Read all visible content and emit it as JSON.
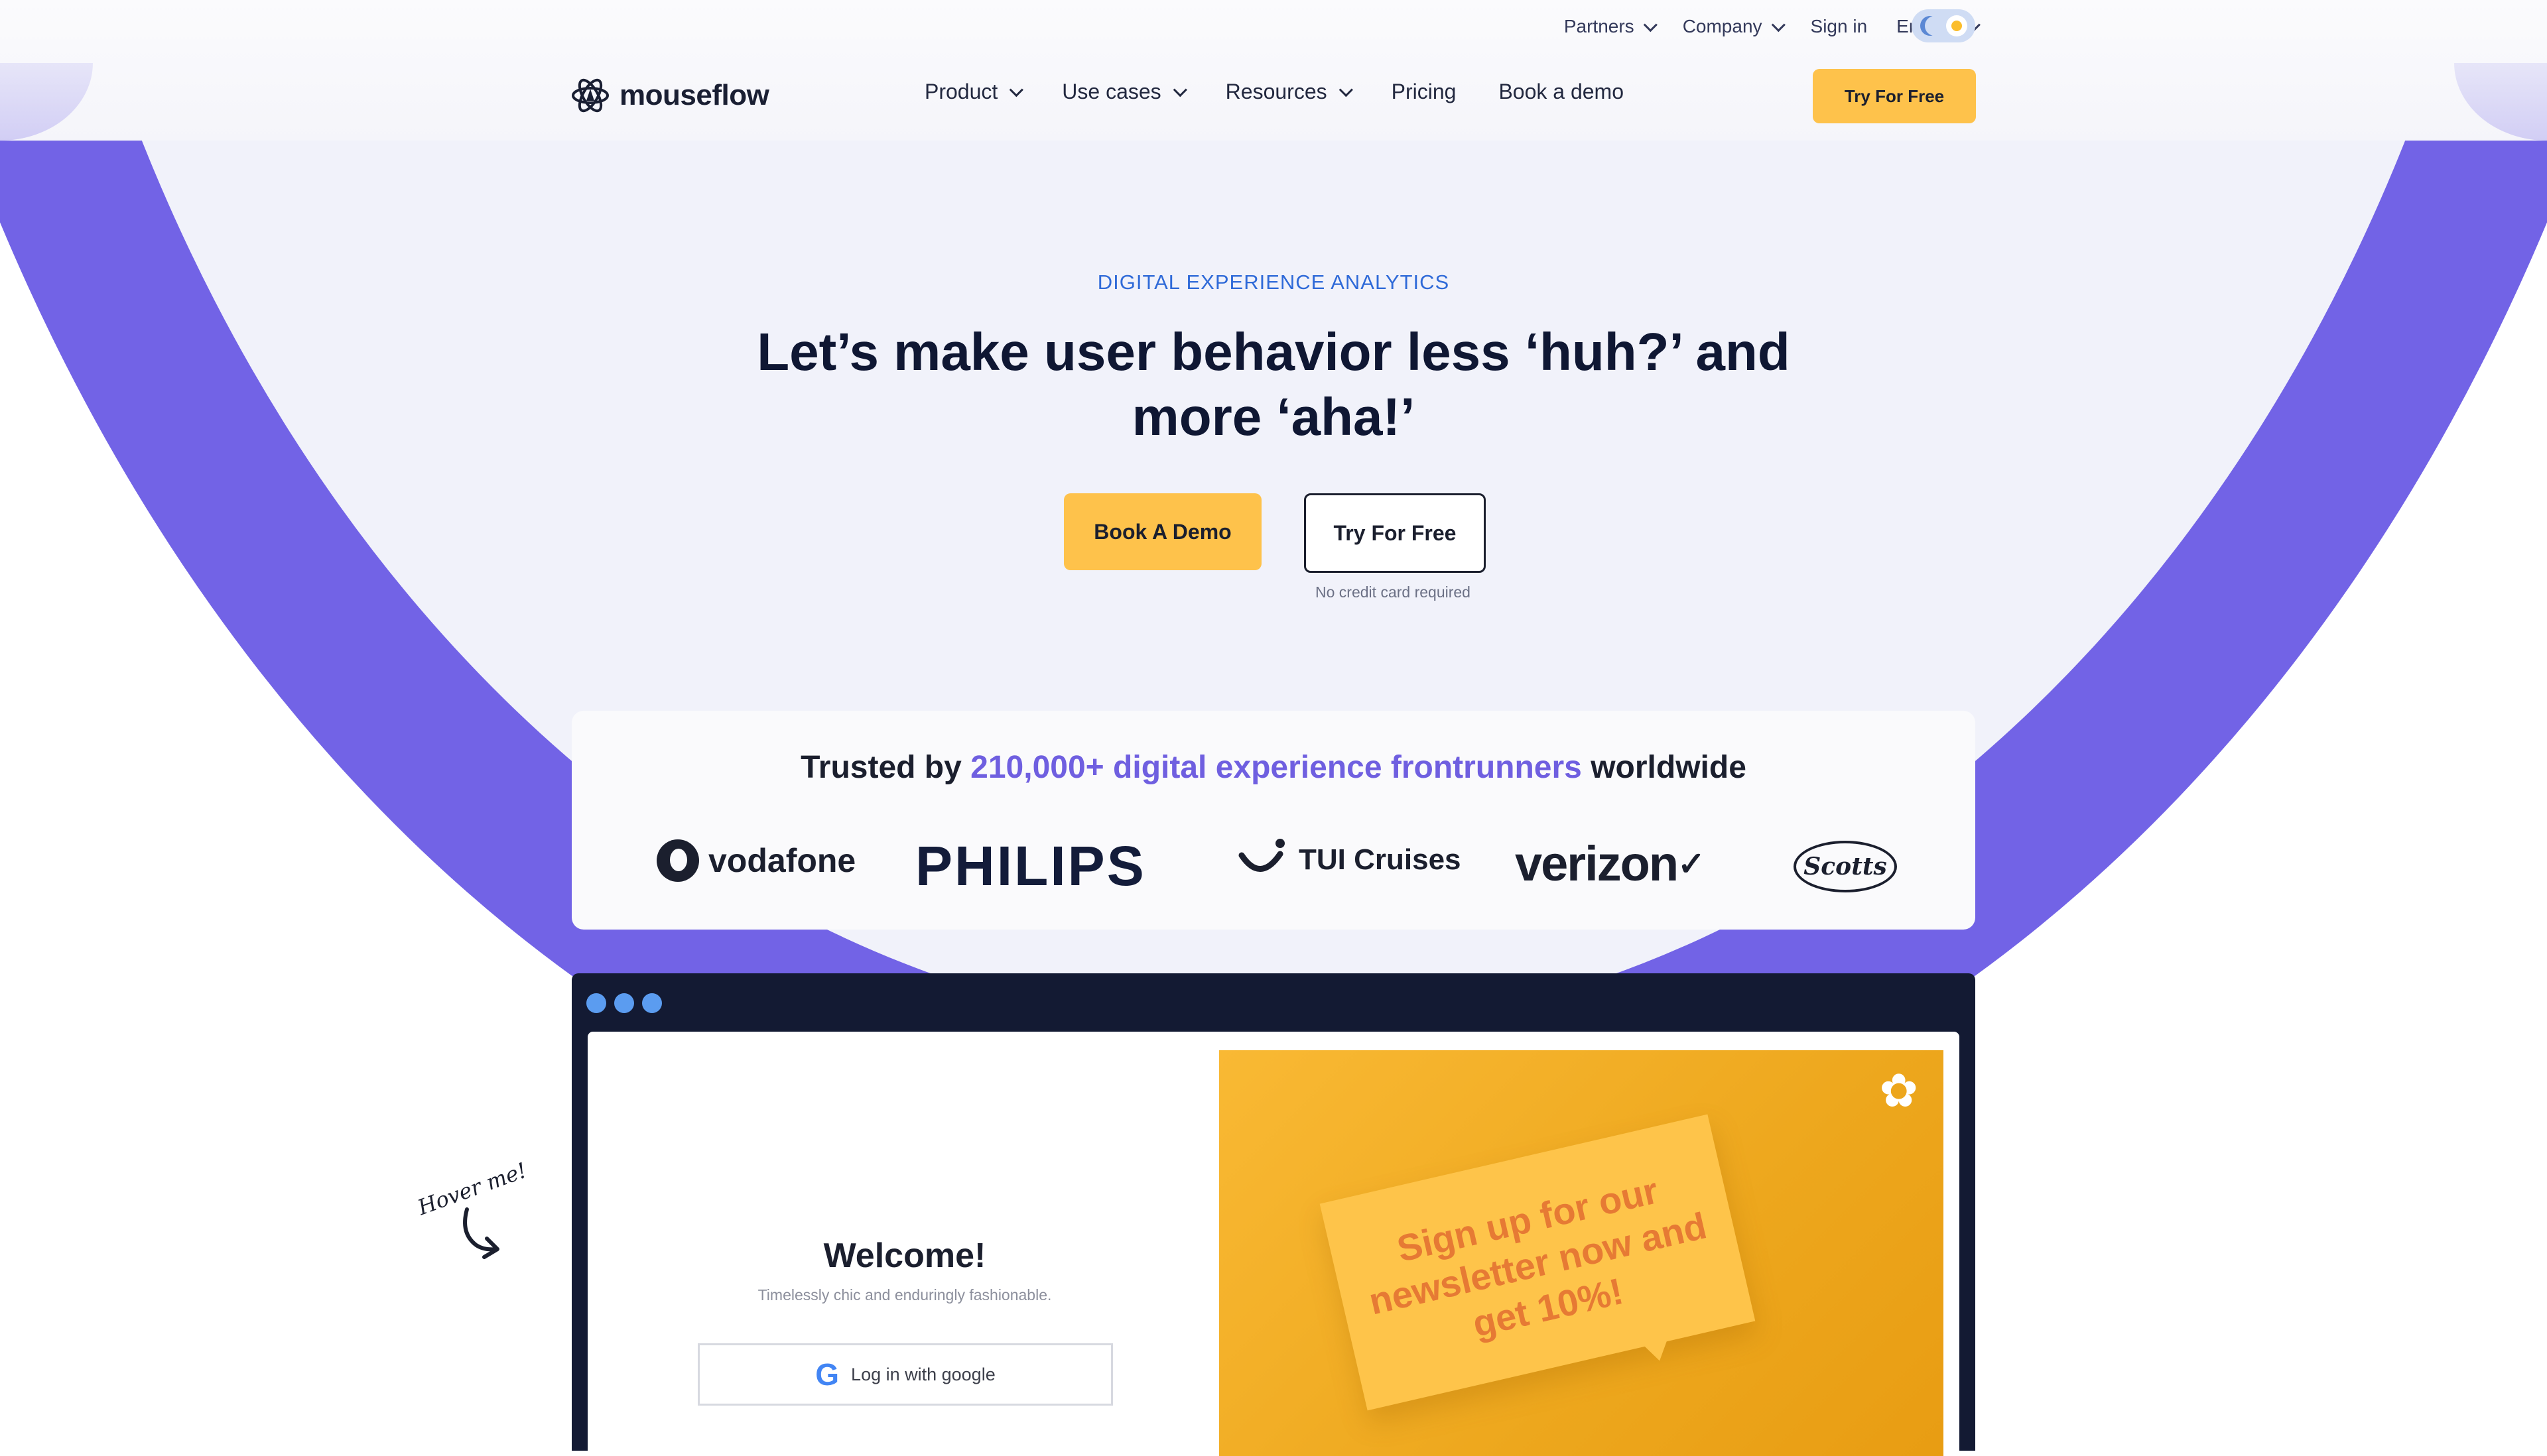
{
  "utility_nav": {
    "partners": "Partners",
    "company": "Company",
    "sign_in": "Sign in",
    "language": "English"
  },
  "main_nav": {
    "logo": "mouseflow",
    "product": "Product",
    "use_cases": "Use cases",
    "resources": "Resources",
    "pricing": "Pricing",
    "book_demo": "Book a demo",
    "cta": "Try For Free"
  },
  "hero": {
    "eyebrow": "DIGITAL EXPERIENCE ANALYTICS",
    "headline": "Let’s make user behavior less ‘huh?’ and more ‘aha!’",
    "primary_button": "Book A Demo",
    "secondary_button": "Try For Free",
    "note": "No credit card required"
  },
  "trusted": {
    "prefix": "Trusted by",
    "highlight": "210,000+ digital experience frontrunners",
    "suffix": "worldwide",
    "logos": [
      "vodafone",
      "PHILIPS",
      "TUI Cruises",
      "verizon",
      "Scotts"
    ]
  },
  "demo": {
    "welcome": "Welcome!",
    "tagline": "Timelessly chic and enduringly fashionable.",
    "google_button": "Log in with google",
    "promo_text": "Sign up for our newsletter now and get 10%!",
    "hover_hint": "Hover me!"
  },
  "colors": {
    "accent_yellow": "#fec24b",
    "purple": "#7263e6",
    "eyebrow_blue": "#2f6ad8",
    "navy": "#131a33"
  },
  "icons": [
    "chevron-down-icon",
    "moon-icon",
    "sun-icon",
    "mouseflow-logo-icon",
    "google-icon",
    "flower-icon",
    "curved-arrow-icon"
  ]
}
